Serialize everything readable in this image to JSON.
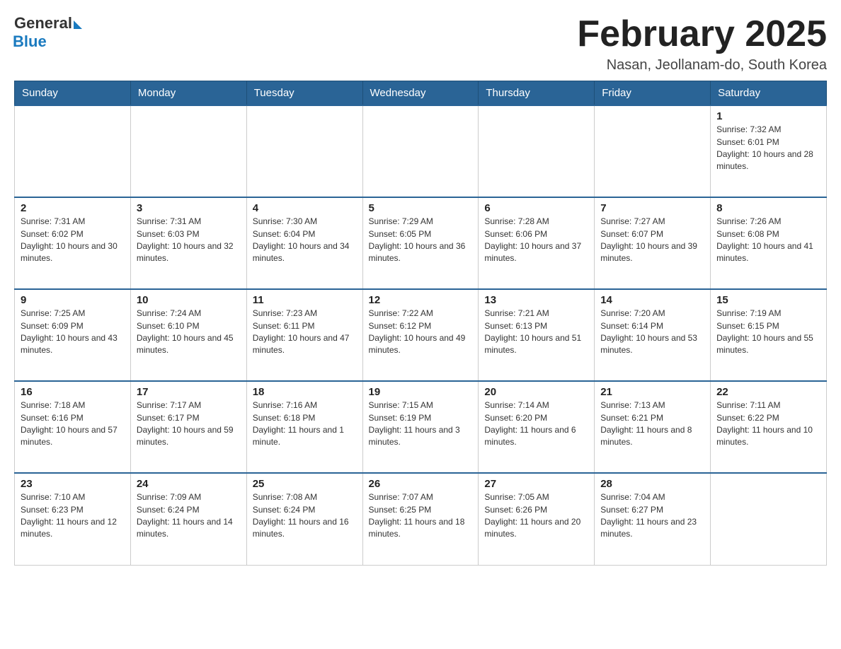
{
  "logo": {
    "general": "General",
    "blue": "Blue"
  },
  "header": {
    "title": "February 2025",
    "location": "Nasan, Jeollanam-do, South Korea"
  },
  "days_of_week": [
    "Sunday",
    "Monday",
    "Tuesday",
    "Wednesday",
    "Thursday",
    "Friday",
    "Saturday"
  ],
  "weeks": [
    [
      {
        "day": "",
        "sunrise": "",
        "sunset": "",
        "daylight": ""
      },
      {
        "day": "",
        "sunrise": "",
        "sunset": "",
        "daylight": ""
      },
      {
        "day": "",
        "sunrise": "",
        "sunset": "",
        "daylight": ""
      },
      {
        "day": "",
        "sunrise": "",
        "sunset": "",
        "daylight": ""
      },
      {
        "day": "",
        "sunrise": "",
        "sunset": "",
        "daylight": ""
      },
      {
        "day": "",
        "sunrise": "",
        "sunset": "",
        "daylight": ""
      },
      {
        "day": "1",
        "sunrise": "Sunrise: 7:32 AM",
        "sunset": "Sunset: 6:01 PM",
        "daylight": "Daylight: 10 hours and 28 minutes."
      }
    ],
    [
      {
        "day": "2",
        "sunrise": "Sunrise: 7:31 AM",
        "sunset": "Sunset: 6:02 PM",
        "daylight": "Daylight: 10 hours and 30 minutes."
      },
      {
        "day": "3",
        "sunrise": "Sunrise: 7:31 AM",
        "sunset": "Sunset: 6:03 PM",
        "daylight": "Daylight: 10 hours and 32 minutes."
      },
      {
        "day": "4",
        "sunrise": "Sunrise: 7:30 AM",
        "sunset": "Sunset: 6:04 PM",
        "daylight": "Daylight: 10 hours and 34 minutes."
      },
      {
        "day": "5",
        "sunrise": "Sunrise: 7:29 AM",
        "sunset": "Sunset: 6:05 PM",
        "daylight": "Daylight: 10 hours and 36 minutes."
      },
      {
        "day": "6",
        "sunrise": "Sunrise: 7:28 AM",
        "sunset": "Sunset: 6:06 PM",
        "daylight": "Daylight: 10 hours and 37 minutes."
      },
      {
        "day": "7",
        "sunrise": "Sunrise: 7:27 AM",
        "sunset": "Sunset: 6:07 PM",
        "daylight": "Daylight: 10 hours and 39 minutes."
      },
      {
        "day": "8",
        "sunrise": "Sunrise: 7:26 AM",
        "sunset": "Sunset: 6:08 PM",
        "daylight": "Daylight: 10 hours and 41 minutes."
      }
    ],
    [
      {
        "day": "9",
        "sunrise": "Sunrise: 7:25 AM",
        "sunset": "Sunset: 6:09 PM",
        "daylight": "Daylight: 10 hours and 43 minutes."
      },
      {
        "day": "10",
        "sunrise": "Sunrise: 7:24 AM",
        "sunset": "Sunset: 6:10 PM",
        "daylight": "Daylight: 10 hours and 45 minutes."
      },
      {
        "day": "11",
        "sunrise": "Sunrise: 7:23 AM",
        "sunset": "Sunset: 6:11 PM",
        "daylight": "Daylight: 10 hours and 47 minutes."
      },
      {
        "day": "12",
        "sunrise": "Sunrise: 7:22 AM",
        "sunset": "Sunset: 6:12 PM",
        "daylight": "Daylight: 10 hours and 49 minutes."
      },
      {
        "day": "13",
        "sunrise": "Sunrise: 7:21 AM",
        "sunset": "Sunset: 6:13 PM",
        "daylight": "Daylight: 10 hours and 51 minutes."
      },
      {
        "day": "14",
        "sunrise": "Sunrise: 7:20 AM",
        "sunset": "Sunset: 6:14 PM",
        "daylight": "Daylight: 10 hours and 53 minutes."
      },
      {
        "day": "15",
        "sunrise": "Sunrise: 7:19 AM",
        "sunset": "Sunset: 6:15 PM",
        "daylight": "Daylight: 10 hours and 55 minutes."
      }
    ],
    [
      {
        "day": "16",
        "sunrise": "Sunrise: 7:18 AM",
        "sunset": "Sunset: 6:16 PM",
        "daylight": "Daylight: 10 hours and 57 minutes."
      },
      {
        "day": "17",
        "sunrise": "Sunrise: 7:17 AM",
        "sunset": "Sunset: 6:17 PM",
        "daylight": "Daylight: 10 hours and 59 minutes."
      },
      {
        "day": "18",
        "sunrise": "Sunrise: 7:16 AM",
        "sunset": "Sunset: 6:18 PM",
        "daylight": "Daylight: 11 hours and 1 minute."
      },
      {
        "day": "19",
        "sunrise": "Sunrise: 7:15 AM",
        "sunset": "Sunset: 6:19 PM",
        "daylight": "Daylight: 11 hours and 3 minutes."
      },
      {
        "day": "20",
        "sunrise": "Sunrise: 7:14 AM",
        "sunset": "Sunset: 6:20 PM",
        "daylight": "Daylight: 11 hours and 6 minutes."
      },
      {
        "day": "21",
        "sunrise": "Sunrise: 7:13 AM",
        "sunset": "Sunset: 6:21 PM",
        "daylight": "Daylight: 11 hours and 8 minutes."
      },
      {
        "day": "22",
        "sunrise": "Sunrise: 7:11 AM",
        "sunset": "Sunset: 6:22 PM",
        "daylight": "Daylight: 11 hours and 10 minutes."
      }
    ],
    [
      {
        "day": "23",
        "sunrise": "Sunrise: 7:10 AM",
        "sunset": "Sunset: 6:23 PM",
        "daylight": "Daylight: 11 hours and 12 minutes."
      },
      {
        "day": "24",
        "sunrise": "Sunrise: 7:09 AM",
        "sunset": "Sunset: 6:24 PM",
        "daylight": "Daylight: 11 hours and 14 minutes."
      },
      {
        "day": "25",
        "sunrise": "Sunrise: 7:08 AM",
        "sunset": "Sunset: 6:24 PM",
        "daylight": "Daylight: 11 hours and 16 minutes."
      },
      {
        "day": "26",
        "sunrise": "Sunrise: 7:07 AM",
        "sunset": "Sunset: 6:25 PM",
        "daylight": "Daylight: 11 hours and 18 minutes."
      },
      {
        "day": "27",
        "sunrise": "Sunrise: 7:05 AM",
        "sunset": "Sunset: 6:26 PM",
        "daylight": "Daylight: 11 hours and 20 minutes."
      },
      {
        "day": "28",
        "sunrise": "Sunrise: 7:04 AM",
        "sunset": "Sunset: 6:27 PM",
        "daylight": "Daylight: 11 hours and 23 minutes."
      },
      {
        "day": "",
        "sunrise": "",
        "sunset": "",
        "daylight": ""
      }
    ]
  ]
}
